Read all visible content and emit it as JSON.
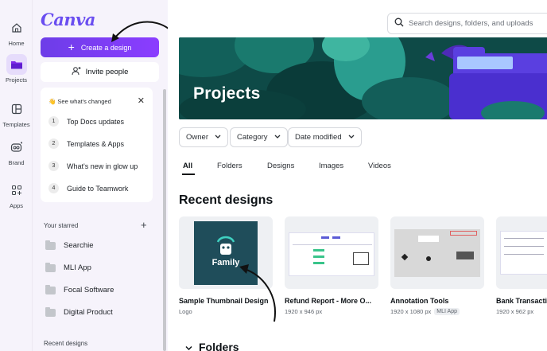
{
  "rail": {
    "items": [
      {
        "label": "Home",
        "icon": "home-icon"
      },
      {
        "label": "Projects",
        "icon": "folder-icon"
      },
      {
        "label": "Templates",
        "icon": "templates-icon"
      },
      {
        "label": "Brand",
        "icon": "brand-icon"
      },
      {
        "label": "Apps",
        "icon": "apps-icon"
      }
    ]
  },
  "sidebar": {
    "logo": "Canva",
    "create_label": "Create a design",
    "invite_label": "Invite people",
    "changed": {
      "title": "👋 See what's changed",
      "items": [
        {
          "num": "1",
          "label": "Top Docs updates"
        },
        {
          "num": "2",
          "label": "Templates & Apps"
        },
        {
          "num": "3",
          "label": "What's new in glow up"
        },
        {
          "num": "4",
          "label": "Guide to Teamwork"
        }
      ]
    },
    "starred_title": "Your starred",
    "starred": [
      "Searchie",
      "MLI App",
      "Focal Software",
      "Digital Product"
    ],
    "recent_title": "Recent designs"
  },
  "main": {
    "search_placeholder": "Search designs, folders, and uploads",
    "banner_title": "Projects",
    "filters": [
      "Owner",
      "Category",
      "Date modified"
    ],
    "tabs": [
      "All",
      "Folders",
      "Designs",
      "Images",
      "Videos"
    ],
    "recent_title": "Recent designs",
    "designs": [
      {
        "title": "Sample Thumbnail Design",
        "meta": "Logo",
        "tag": "",
        "thumb_text": "Family"
      },
      {
        "title": "Refund Report - More O...",
        "meta": "1920 x 946 px",
        "tag": ""
      },
      {
        "title": "Annotation Tools",
        "meta": "1920 x 1080 px",
        "tag": "MLI App"
      },
      {
        "title": "Bank Transacti",
        "meta": "1920 x 962 px",
        "tag": ""
      }
    ],
    "folders_title": "Folders"
  },
  "colors": {
    "accent": "#8b3dff",
    "banner": "#0f4f4b",
    "thumb_family": "#1f4d5a"
  }
}
